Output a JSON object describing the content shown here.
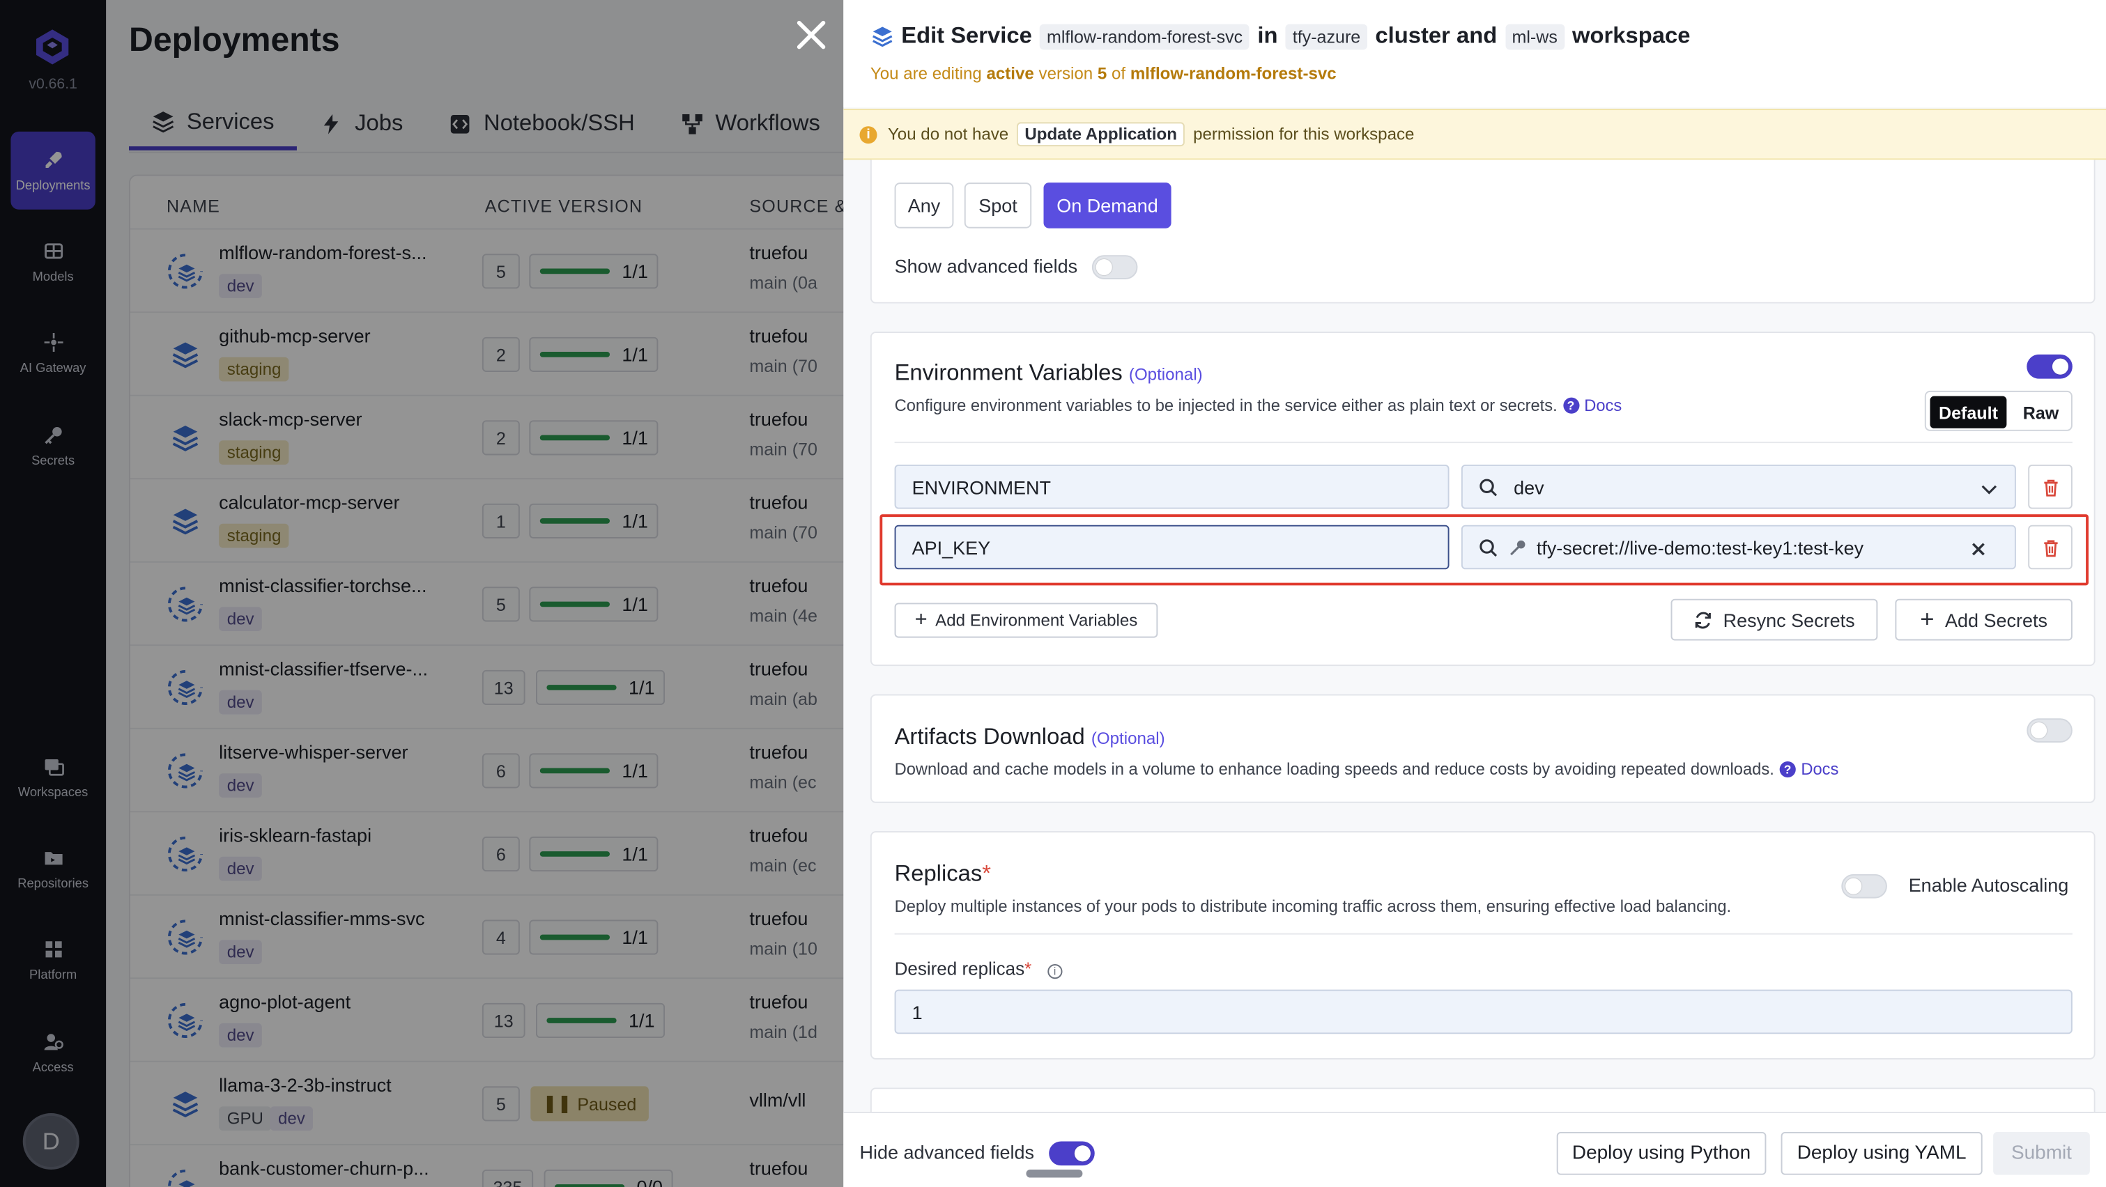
{
  "sidebar": {
    "version": "v0.66.1",
    "items": [
      {
        "label": "Deployments",
        "icon": "rocket-icon",
        "active": true
      },
      {
        "label": "Models",
        "icon": "grid-icon"
      },
      {
        "label": "AI Gateway",
        "icon": "gateway-icon"
      },
      {
        "label": "Secrets",
        "icon": "key-icon"
      },
      {
        "label": "Workspaces",
        "icon": "workspaces-icon"
      },
      {
        "label": "Repositories",
        "icon": "folder-icon"
      },
      {
        "label": "Platform",
        "icon": "platform-icon"
      },
      {
        "label": "Access",
        "icon": "users-icon"
      }
    ],
    "avatar": "D"
  },
  "deployments": {
    "title": "Deployments",
    "tabs": [
      "Services",
      "Jobs",
      "Notebook/SSH",
      "Workflows"
    ],
    "columns": [
      "NAME",
      "ACTIVE VERSION",
      "SOURCE &"
    ],
    "rows": [
      {
        "name": "mlflow-random-forest-s...",
        "tags": [
          "dev"
        ],
        "version": "5",
        "pods": "1/1",
        "source": "truefou",
        "branch": "main (0a"
      },
      {
        "name": "github-mcp-server",
        "tags": [
          "staging"
        ],
        "version": "2",
        "pods": "1/1",
        "source": "truefou",
        "branch": "main (70"
      },
      {
        "name": "slack-mcp-server",
        "tags": [
          "staging"
        ],
        "version": "2",
        "pods": "1/1",
        "source": "truefou",
        "branch": "main (70"
      },
      {
        "name": "calculator-mcp-server",
        "tags": [
          "staging"
        ],
        "version": "1",
        "pods": "1/1",
        "source": "truefou",
        "branch": "main (70"
      },
      {
        "name": "mnist-classifier-torchse...",
        "tags": [
          "dev"
        ],
        "version": "5",
        "pods": "1/1",
        "source": "truefou",
        "branch": "main (4e"
      },
      {
        "name": "mnist-classifier-tfserve-...",
        "tags": [
          "dev"
        ],
        "version": "13",
        "pods": "1/1",
        "source": "truefou",
        "branch": "main (ab"
      },
      {
        "name": "litserve-whisper-server",
        "tags": [
          "dev"
        ],
        "version": "6",
        "pods": "1/1",
        "source": "truefou",
        "branch": "main (ec"
      },
      {
        "name": "iris-sklearn-fastapi",
        "tags": [
          "dev"
        ],
        "version": "6",
        "pods": "1/1",
        "source": "truefou",
        "branch": "main (ec"
      },
      {
        "name": "mnist-classifier-mms-svc",
        "tags": [
          "dev"
        ],
        "version": "4",
        "pods": "1/1",
        "source": "truefou",
        "branch": "main (10"
      },
      {
        "name": "agno-plot-agent",
        "tags": [
          "dev"
        ],
        "version": "13",
        "pods": "1/1",
        "source": "truefou",
        "branch": "main (1d"
      },
      {
        "name": "llama-3-2-3b-instruct",
        "tags": [
          "GPU",
          "dev"
        ],
        "version": "5",
        "pods": "Paused",
        "source": "vllm/vll",
        "branch": ""
      },
      {
        "name": "bank-customer-churn-p...",
        "tags": [],
        "version": "335",
        "pods": "0/0",
        "source": "truefou",
        "branch": ""
      }
    ]
  },
  "edit": {
    "title_prefix": "Edit Service",
    "service": "mlflow-random-forest-svc",
    "in": "in",
    "cluster": "tfy-azure",
    "cluster_word": "cluster and",
    "workspace": "ml-ws",
    "workspace_word": "workspace",
    "note_prefix": "You are editing",
    "note_active": "active",
    "note_version": "version",
    "note_version_num": "5",
    "note_of": "of",
    "note_service": "mlflow-random-forest-svc",
    "warning_prefix": "You do not have",
    "warning_permission": "Update Application",
    "warning_suffix": "permission for this workspace"
  },
  "capacity": {
    "options": [
      "Any",
      "Spot",
      "On Demand"
    ],
    "selected": "On Demand",
    "show_advanced_label": "Show advanced fields"
  },
  "env": {
    "title": "Environment Variables",
    "optional": "(Optional)",
    "description": "Configure environment variables to be injected in the service either as plain text or secrets.",
    "docs": "Docs",
    "mode_default": "Default",
    "mode_raw": "Raw",
    "vars": [
      {
        "key": "ENVIRONMENT",
        "value": "dev"
      },
      {
        "key": "API_KEY",
        "value": "tfy-secret://live-demo:test-key1:test-key"
      }
    ],
    "add_label": "Add Environment Variables",
    "resync_label": "Resync Secrets",
    "add_secrets_label": "Add Secrets"
  },
  "artifacts": {
    "title": "Artifacts Download",
    "optional": "(Optional)",
    "description": "Download and cache models in a volume to enhance loading speeds and reduce costs by avoiding repeated downloads.",
    "docs": "Docs"
  },
  "replicas": {
    "title": "Replicas",
    "required": "*",
    "description": "Deploy multiple instances of your pods to distribute incoming traffic across them, ensuring effective load balancing.",
    "autoscaling_label": "Enable Autoscaling",
    "desired_label": "Desired replicas",
    "desired_value": "1"
  },
  "footer": {
    "hide_advanced_label": "Hide advanced fields",
    "deploy_python": "Deploy using Python",
    "deploy_yaml": "Deploy using YAML",
    "submit": "Submit"
  },
  "colors": {
    "accent": "#4b3fc9",
    "warning_bg": "#fdf6dc",
    "highlight": "#e03a2e"
  }
}
